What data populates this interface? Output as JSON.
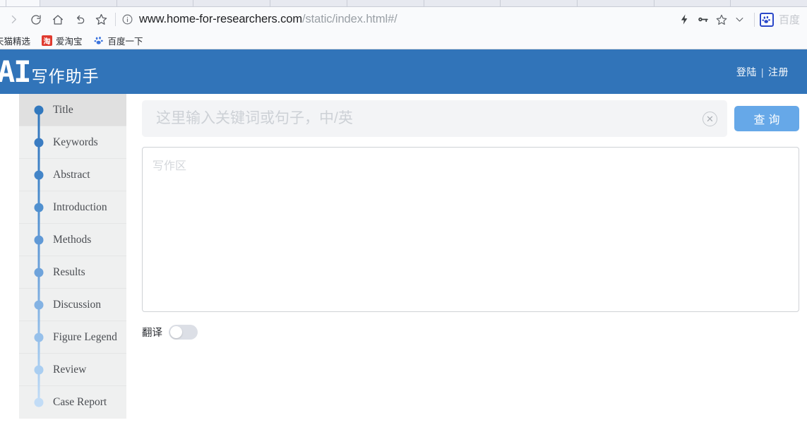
{
  "browser": {
    "toolbar_icons": [
      {
        "name": "forward-nav-icon",
        "glyph": "chevron-right",
        "disabled": true
      },
      {
        "name": "reload-icon",
        "glyph": "reload"
      },
      {
        "name": "home-icon",
        "glyph": "home"
      },
      {
        "name": "back-arrow-icon",
        "glyph": "undo-arrow"
      },
      {
        "name": "bookmark-star-icon",
        "glyph": "star"
      }
    ],
    "url_host": "www.home-for-researchers.com",
    "url_path": "/static/index.html#/",
    "site_info_icon": "info-circle-icon",
    "right_icons": [
      {
        "name": "lightning-bolt-icon",
        "glyph": "bolt"
      },
      {
        "name": "key-icon",
        "glyph": "key"
      },
      {
        "name": "favorite-star-icon",
        "glyph": "star"
      },
      {
        "name": "chevron-down-icon",
        "glyph": "chevron-down"
      }
    ],
    "extension": {
      "icon_name": "baidu-paw-icon",
      "label": "百度"
    },
    "bookmarks": [
      {
        "label": "天猫精选",
        "icon": "tmall-icon",
        "clipped": true
      },
      {
        "label": "爱淘宝",
        "icon": "taobao-icon",
        "icon_text": "淘"
      },
      {
        "label": "百度一下",
        "icon": "baidu-paw-icon"
      }
    ]
  },
  "header": {
    "logo_mark": "AI",
    "logo_text": "写作助手",
    "login_label": "登陆",
    "separator": "|",
    "register_label": "注册"
  },
  "sidebar": {
    "active_index": 0,
    "items": [
      {
        "label": "Title",
        "dot_color": "#3178be"
      },
      {
        "label": "Keywords",
        "dot_color": "#3a7cc2"
      },
      {
        "label": "Abstract",
        "dot_color": "#4385c8"
      },
      {
        "label": "Introduction",
        "dot_color": "#5090cf"
      },
      {
        "label": "Methods",
        "dot_color": "#6099d6"
      },
      {
        "label": "Results",
        "dot_color": "#6ea3db"
      },
      {
        "label": "Discussion",
        "dot_color": "#83b2e3"
      },
      {
        "label": "Figure Legend",
        "dot_color": "#96c0ea"
      },
      {
        "label": "Review",
        "dot_color": "#aacef1"
      },
      {
        "label": "Case Report",
        "dot_color": "#c2dcf6"
      }
    ]
  },
  "main": {
    "search": {
      "value": "",
      "placeholder": "这里输入关键词或句子，中/英",
      "clear_icon": "clear-circle-icon",
      "clear_glyph": "✕",
      "query_button_label": "查询"
    },
    "editor": {
      "value": "",
      "placeholder": "写作区"
    },
    "translate": {
      "label": "翻译",
      "enabled": false
    }
  },
  "colors": {
    "header_blue": "#3174b9",
    "button_blue": "#66a8e8",
    "sidebar_bg": "#eff0f0",
    "sidebar_active_bg": "#e0e0e0",
    "search_bg": "#f3f4f6"
  }
}
